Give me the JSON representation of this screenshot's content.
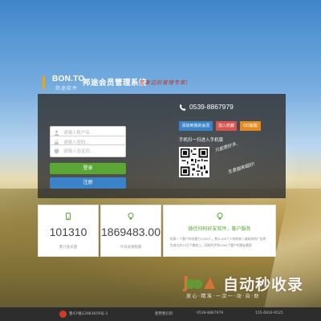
{
  "brand": {
    "logo_name": "BON.TO",
    "logo_sub": "邦途软件",
    "title": "邦途会员管理系统",
    "slogan": "您身边的管理专家!"
  },
  "login": {
    "username_placeholder": "请输入账户名...",
    "password_placeholder": "请输入密码...",
    "code_placeholder": "请输入验证码...",
    "login_label": "登录",
    "register_label": "注册"
  },
  "contact": {
    "phone": "0539-8867979",
    "buttons": [
      {
        "label": "添加到我的会员",
        "color": "#3b83c9"
      },
      {
        "label": "加入收藏",
        "color": "#d9534f"
      },
      {
        "label": "QQ客服",
        "color": "#e58a1f"
      }
    ],
    "scan_title": "手机扫一扫进入手机版",
    "handwrite_1": "只能更好多,",
    "handwrite_2": "生意越来越好!"
  },
  "stats": [
    {
      "icon": "phone-icon",
      "value": "101310",
      "caption": "累计会员量"
    },
    {
      "icon": "bulb-icon",
      "value": "1869483.00",
      "caption": "今日总销售额"
    }
  ],
  "promo": {
    "icon": "bulb-icon",
    "heading": "微信扫码好友软件，客户服务",
    "text": "短周一个客户的处理力1000人，那么100个人的的老二维码的的广告将生成大约10万个微信上，同时同步到1000个客户的朋友圈里"
  },
  "watermark": {
    "title": "自动秒收录",
    "subtitle": "放心·精准·一次一·动·自·助"
  },
  "footer": {
    "icp": "鲁ICP备12983659号-3",
    "links": "使用我们的",
    "phone_label": "0539-8867979",
    "mobile": "155-6916-9525"
  },
  "colors": {
    "green": "#5aa735",
    "blue": "#3b83c9",
    "panel": "#303030"
  }
}
